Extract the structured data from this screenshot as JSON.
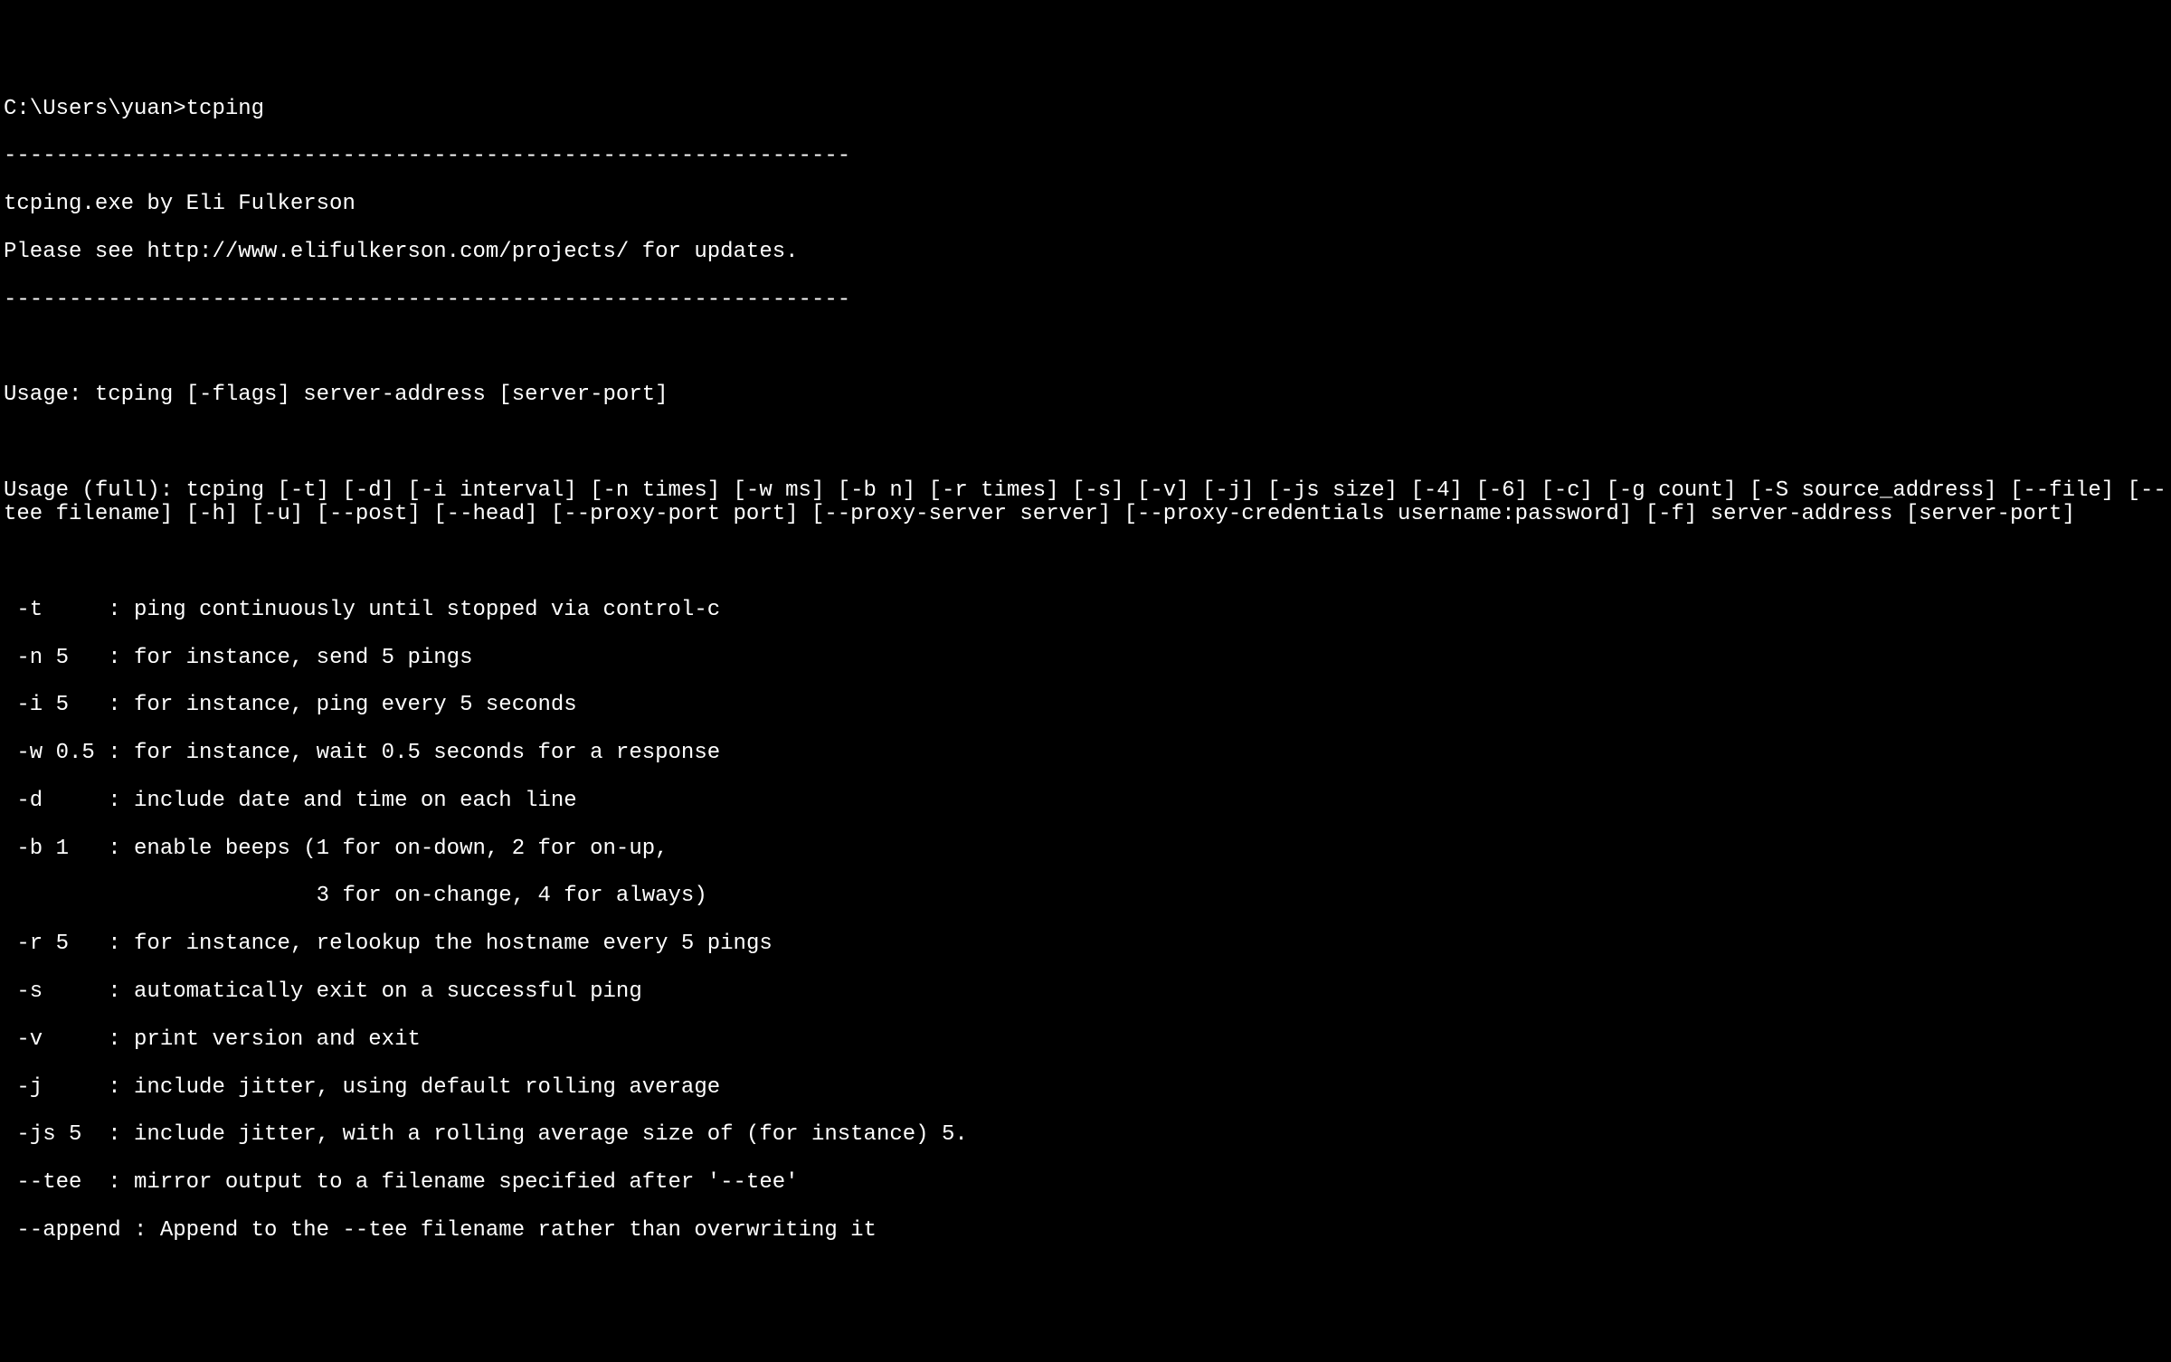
{
  "terminal": {
    "prompt": "C:\\Users\\yuan>",
    "command": "tcping",
    "divider": "-----------------------------------------------------------------",
    "header_line1": "tcping.exe by Eli Fulkerson",
    "header_line2": "Please see http://www.elifulkerson.com/projects/ for updates.",
    "usage_short": "Usage: tcping [-flags] server-address [server-port]",
    "usage_full": "Usage (full): tcping [-t] [-d] [-i interval] [-n times] [-w ms] [-b n] [-r times] [-s] [-v] [-j] [-js size] [-4] [-6] [-c] [-g count] [-S source_address] [--file] [--tee filename] [-h] [-u] [--post] [--head] [--proxy-port port] [--proxy-server server] [--proxy-credentials username:password] [-f] server-address [server-port]",
    "options": {
      "t": " -t     : ping continuously until stopped via control-c",
      "n": " -n 5   : for instance, send 5 pings",
      "i": " -i 5   : for instance, ping every 5 seconds",
      "w": " -w 0.5 : for instance, wait 0.5 seconds for a response",
      "d": " -d     : include date and time on each line",
      "b1": " -b 1   : enable beeps (1 for on-down, 2 for on-up,",
      "b2": "                        3 for on-change, 4 for always)",
      "r": " -r 5   : for instance, relookup the hostname every 5 pings",
      "s": " -s     : automatically exit on a successful ping",
      "v": " -v     : print version and exit",
      "j": " -j     : include jitter, using default rolling average",
      "js": " -js 5  : include jitter, with a rolling average size of (for instance) 5.",
      "tee": " --tee  : mirror output to a filename specified after '--tee'",
      "append": " --append : Append to the --tee filename rather than overwriting it"
    }
  }
}
